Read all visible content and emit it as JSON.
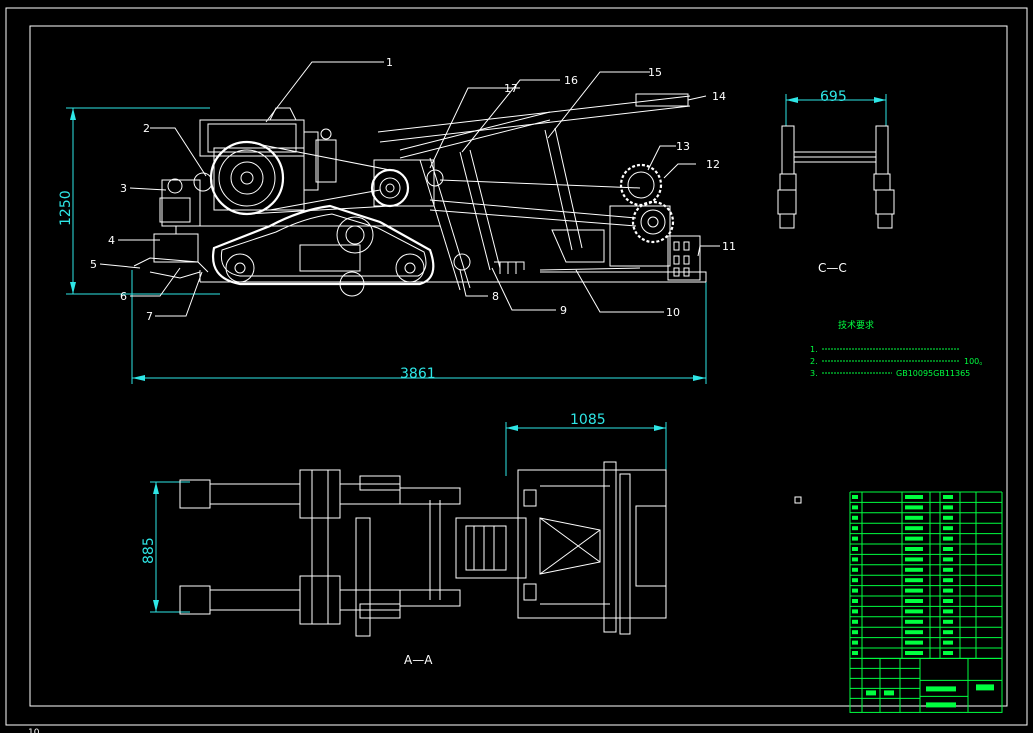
{
  "dimensions": {
    "height_side": "1250",
    "length_side": "3861",
    "width_cc": "695",
    "width_aa_top": "1085",
    "height_aa": "885"
  },
  "sections": {
    "cc": "C—C",
    "aa": "A—A"
  },
  "callouts": [
    "1",
    "2",
    "3",
    "4",
    "5",
    "6",
    "7",
    "8",
    "9",
    "10",
    "11",
    "12",
    "13",
    "14",
    "15",
    "16",
    "17"
  ],
  "tech_req": {
    "title": "技术要求",
    "lines": [
      "1.",
      "2.",
      "100。",
      "3.",
      "GB10095GB11365"
    ]
  },
  "bottom_label": "10",
  "colors": {
    "background": "#000000",
    "lines": "#ffffff",
    "dimensions": "#2ee6e6",
    "table": "#00ff40"
  }
}
